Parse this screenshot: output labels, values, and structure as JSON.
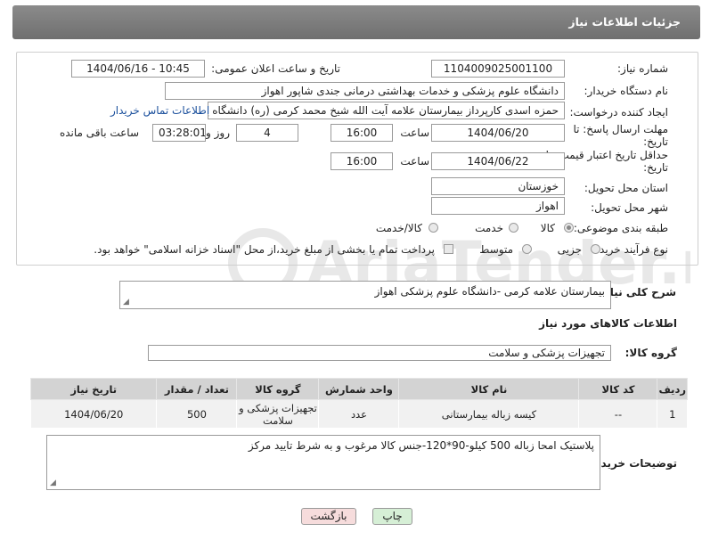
{
  "header": {
    "title": "جزئیات اطلاعات نیاز"
  },
  "form": {
    "need_number_label": "شماره نیاز:",
    "need_number": "1104009025001100",
    "announce_label": "تاریخ و ساعت اعلان عمومی:",
    "announce_value": "1404/06/16 - 10:45",
    "buyer_org_label": "نام دستگاه خریدار:",
    "buyer_org": "دانشگاه علوم پزشکی و خدمات بهداشتی درمانی جندی شاپور اهواز",
    "creator_label": "ایجاد کننده درخواست:",
    "creator": "حمزه اسدی کارپرداز بیمارستان علامه آیت الله شیخ محمد کرمی (ره) دانشگاه ع",
    "contact_link": "اطلاعات تماس خریدار",
    "deadline_label": "مهلت ارسال پاسخ: تا تاریخ:",
    "deadline_date": "1404/06/20",
    "time_label": "ساعت",
    "deadline_time": "16:00",
    "days_value": "4",
    "days_label": "روز و",
    "remaining_value": "03:28:01",
    "remaining_label": "ساعت باقی مانده",
    "price_label": "حداقل تاریخ اعتبار قیمت: تا تاریخ:",
    "price_date": "1404/06/22",
    "price_time": "16:00",
    "province_label": "استان محل تحویل:",
    "province": "خوزستان",
    "city_label": "شهر محل تحویل:",
    "city": "اهواز",
    "category_label": "طبقه بندی موضوعی:",
    "category_options": [
      "کالا",
      "خدمت",
      "کالا/خدمت"
    ],
    "process_label": "نوع فرآیند خرید :",
    "process_options": [
      "جزیی",
      "متوسط"
    ],
    "payment_note": "پرداخت تمام یا بخشی از مبلغ خرید،از محل \"اسناد خزانه اسلامی\" خواهد بود."
  },
  "description": {
    "label": "شرح کلی نیاز:",
    "value": "بیمارستان علامه کرمی -دانشگاه علوم پزشکی اهواز"
  },
  "goods": {
    "section_title": "اطلاعات کالاهای مورد نیاز",
    "group_label": "گروه کالا:",
    "group_value": "تجهیزات پزشکی و سلامت",
    "columns": [
      "ردیف",
      "کد کالا",
      "نام کالا",
      "واحد شمارش",
      "گروه کالا",
      "تعداد / مقدار",
      "تاریخ نیاز"
    ],
    "rows": [
      [
        "1",
        "--",
        "کیسه زباله بیمارستانی",
        "عدد",
        "تجهیزات پزشکی و سلامت",
        "500",
        "1404/06/20"
      ]
    ]
  },
  "buyer_notes": {
    "label": "توضیحات خریدار:",
    "value": "پلاستیک امحا زباله 500 کیلو-90*120-جنس کالا مرغوب و به شرط تایید مرکز"
  },
  "buttons": {
    "print": "چاپ",
    "back": "بازگشت"
  },
  "watermark": {
    "text": "AriaTender.neT"
  },
  "colors": {
    "header_bg": "#7c7c7c",
    "link": "#1a4f9c",
    "back_btn": "#f6dcdc",
    "print_btn": "#d6efd6"
  }
}
